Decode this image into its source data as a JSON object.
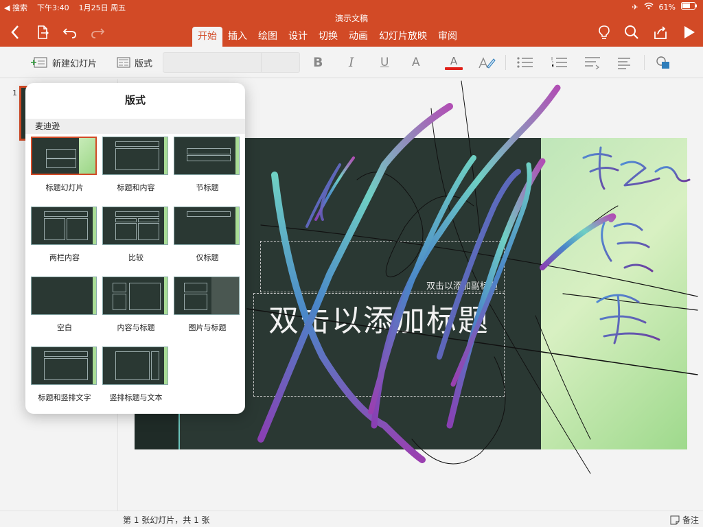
{
  "status_bar": {
    "back_app": "◀ 搜索",
    "time": "下午3:40",
    "date": "1月25日 周五",
    "battery": "61%"
  },
  "document": {
    "title": "演示文稿"
  },
  "tabs": [
    {
      "label": "开始",
      "active": true
    },
    {
      "label": "插入"
    },
    {
      "label": "绘图"
    },
    {
      "label": "设计"
    },
    {
      "label": "切换"
    },
    {
      "label": "动画"
    },
    {
      "label": "幻灯片放映"
    },
    {
      "label": "审阅"
    }
  ],
  "ribbon": {
    "new_slide_label": "新建幻灯片",
    "layout_label": "版式",
    "bold": "B",
    "italic": "I",
    "underline": "U",
    "font_glyph": "A",
    "font_color_glyph": "A"
  },
  "rail": {
    "slide_number": "1"
  },
  "slide": {
    "subtitle_placeholder": "双击以添加副标题",
    "title_placeholder": "双击以添加标题"
  },
  "layout_popover": {
    "title": "版式",
    "section": "麦迪逊",
    "items": [
      {
        "label": "标题幻灯片",
        "selected": true
      },
      {
        "label": "标题和内容"
      },
      {
        "label": "节标题"
      },
      {
        "label": "两栏内容"
      },
      {
        "label": "比较"
      },
      {
        "label": "仅标题"
      },
      {
        "label": "空白"
      },
      {
        "label": "内容与标题"
      },
      {
        "label": "图片与标题"
      },
      {
        "label": "标题和竖排文字"
      },
      {
        "label": "竖排标题与文本"
      }
    ]
  },
  "footer": {
    "slide_count": "第 1 张幻灯片，共 1 张",
    "notes_label": "备注"
  },
  "colors": {
    "accent": "#d24a26",
    "slide_bg": "#2a3833"
  }
}
